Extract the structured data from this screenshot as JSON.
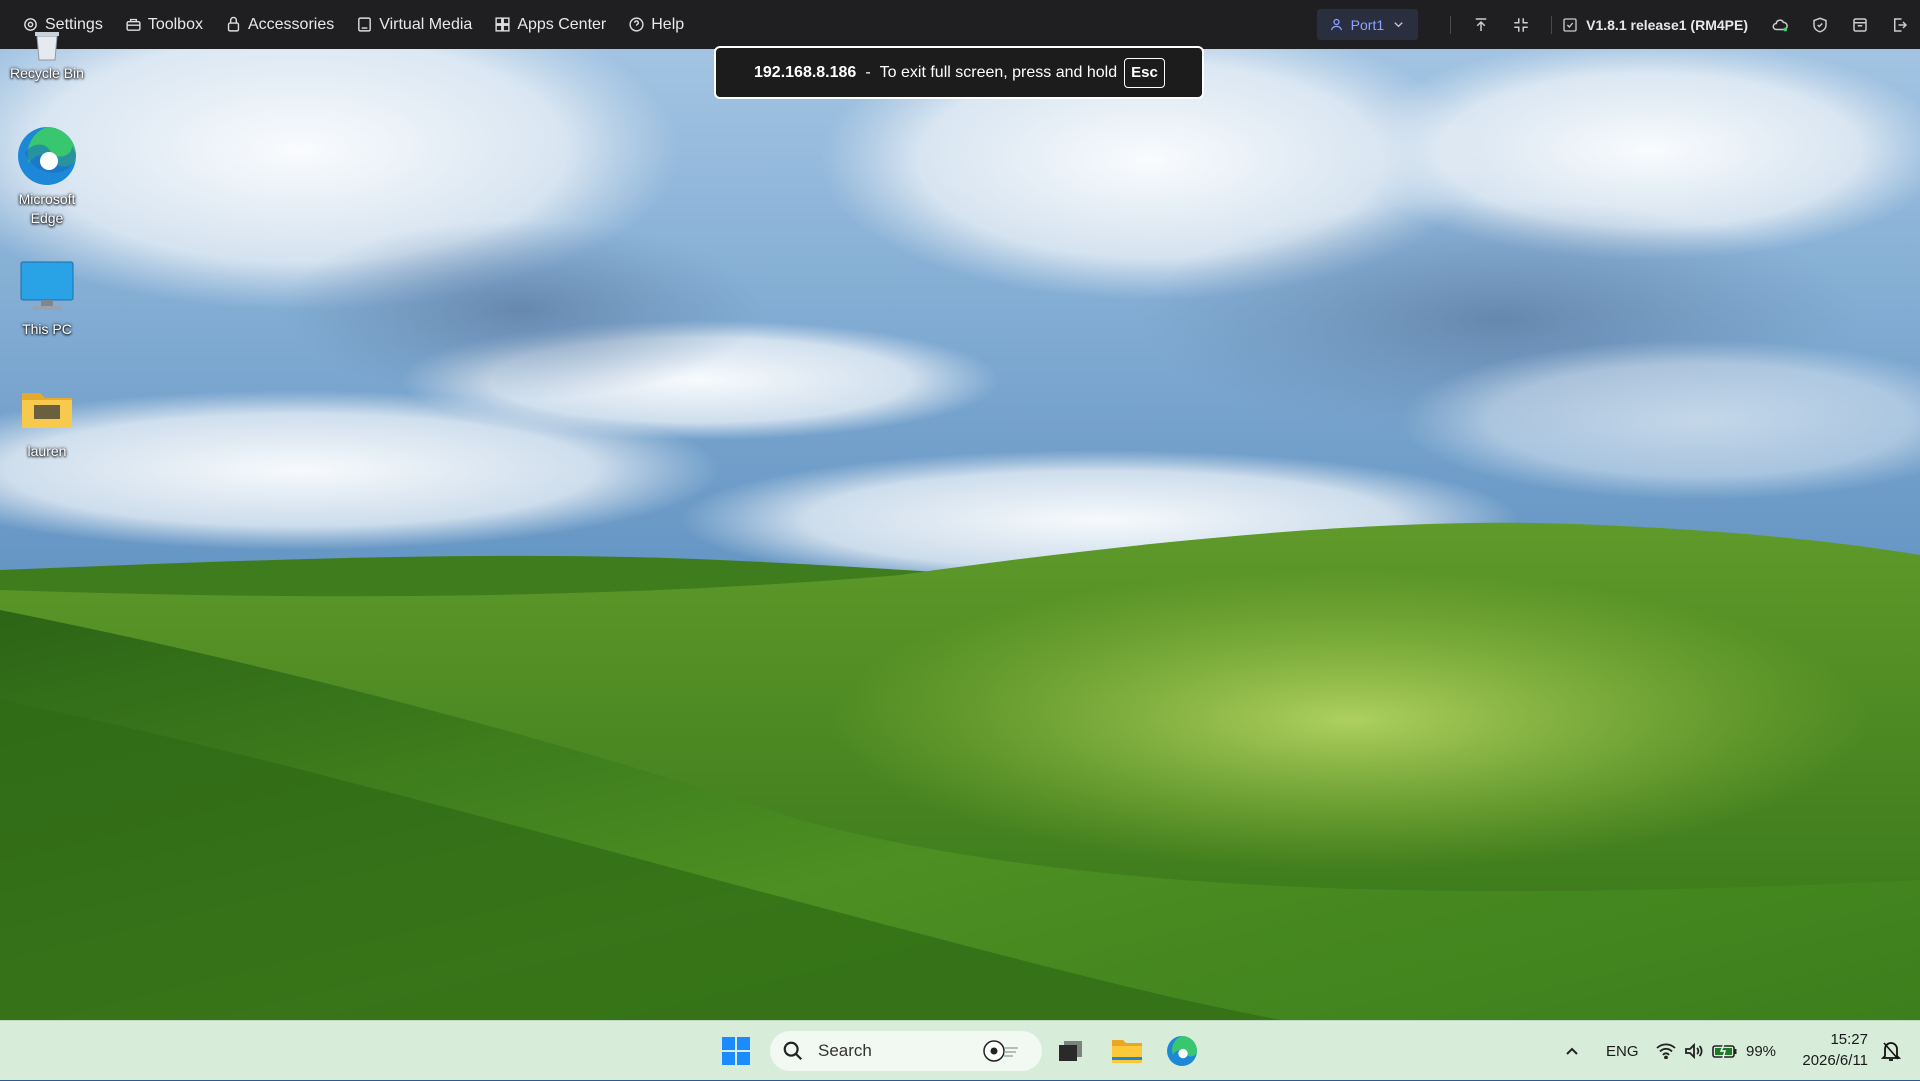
{
  "toolbar": {
    "menu": [
      {
        "label": "Settings",
        "icon": "gear-icon"
      },
      {
        "label": "Toolbox",
        "icon": "toolbox-icon"
      },
      {
        "label": "Accessories",
        "icon": "accessories-icon"
      },
      {
        "label": "Virtual Media",
        "icon": "virtual-media-icon"
      },
      {
        "label": "Apps Center",
        "icon": "apps-icon"
      },
      {
        "label": "Help",
        "icon": "help-icon"
      }
    ],
    "port_label": "Port1",
    "version_label": "V1.8.1 release1 (RM4PE)",
    "accent_color": "#8ea2ff"
  },
  "fullscreen_notice": {
    "host": "192.168.8.186",
    "separator": "-",
    "message": "To exit full screen, press and hold",
    "key": "Esc"
  },
  "desktop": {
    "icons": [
      {
        "label": "Recycle Bin",
        "icon": "recycle-bin-icon"
      },
      {
        "label": "Microsoft Edge",
        "icon": "edge-icon"
      },
      {
        "label": "This PC",
        "icon": "monitor-icon"
      },
      {
        "label": "lauren",
        "icon": "folder-icon"
      }
    ]
  },
  "taskbar": {
    "search_placeholder": "Search",
    "pinned": [
      "windows-start-icon",
      "task-view-icon",
      "file-explorer-icon",
      "edge-icon"
    ],
    "tray": {
      "language": "ENG",
      "battery": "99%",
      "time": "15:27",
      "date": "2026/6/11"
    },
    "background_color": "#d7ecd9"
  }
}
